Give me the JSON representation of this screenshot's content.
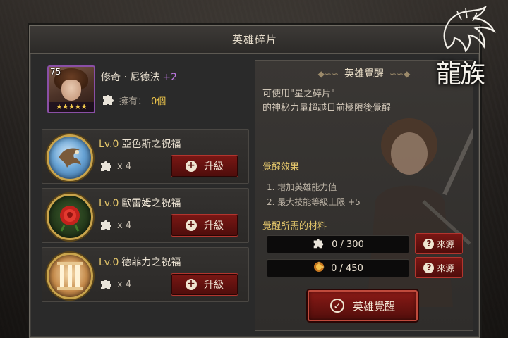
{
  "window": {
    "title": "英雄碎片"
  },
  "logo": {
    "text": "龍族"
  },
  "hero": {
    "level": "75",
    "name": "修奇 · 尼德法",
    "plus": "+2",
    "stars": "★★★★★",
    "owned_label": "擁有：",
    "owned_value": "0個"
  },
  "blessings": [
    {
      "lv": "Lv.0",
      "name": "亞色斯之祝福",
      "qty": "x 4",
      "button": "升級",
      "icon": "eagle-orb"
    },
    {
      "lv": "Lv.0",
      "name": "歐雷姆之祝福",
      "qty": "x 4",
      "button": "升級",
      "icon": "rose-orb"
    },
    {
      "lv": "Lv.0",
      "name": "德菲力之祝福",
      "qty": "x 4",
      "button": "升級",
      "icon": "pillar-orb"
    }
  ],
  "awaken": {
    "title": "英雄覺醒",
    "desc_line1": "可使用\"星之碎片\"",
    "desc_line2": "的神秘力量超越目前極限後覺醒",
    "effects_label": "覺醒效果",
    "effects": [
      "1. 增加英雄能力值",
      "2. 最大技能等級上限 +5"
    ],
    "materials_label": "覺醒所需的材料",
    "materials": [
      {
        "value": "0 / 300",
        "icon": "puzzle-icon",
        "button": "來源"
      },
      {
        "value": "0 / 450",
        "icon": "gold-shard-icon",
        "button": "來源"
      }
    ],
    "button": "英雄覺醒"
  },
  "colors": {
    "accent_gold": "#e5c76b",
    "button_red": "#7a1714",
    "plus_purple": "#c07ae6"
  }
}
